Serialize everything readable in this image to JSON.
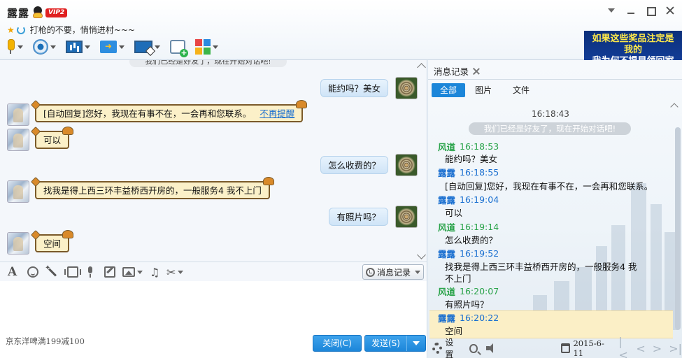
{
  "header": {
    "contact_name": "露露",
    "vip_badge": "VIP2",
    "signature": "打枪的不要，悄悄进村~~~"
  },
  "ad_banner": {
    "line1": "如果这些奖品注定是我的",
    "line2": "我为何不提早领回家"
  },
  "chat": {
    "system_top": "我们已经是好友了，现在开始对话吧!",
    "messages": [
      {
        "from": "me",
        "text": "能约吗？美女"
      },
      {
        "from": "peer",
        "text": "[自动回复]您好，我现在有事不在，一会再和您联系。",
        "link": "不再提醒"
      },
      {
        "from": "peer",
        "text": "可以"
      },
      {
        "from": "me",
        "text": "怎么收费的？"
      },
      {
        "from": "peer",
        "text": "找我是得上西三环丰益桥西开房的，一般服务4   我不上门"
      },
      {
        "from": "me",
        "text": "有照片吗？"
      },
      {
        "from": "peer",
        "text": "空间"
      }
    ]
  },
  "input_toolbar": {
    "history_label": "消息记录"
  },
  "footer": {
    "ad_text": "京东洋啤满199减100",
    "close_label": "关闭(C)",
    "send_label": "发送(S)"
  },
  "history": {
    "tab_label": "消息记录",
    "filters": [
      "全部",
      "图片",
      "文件"
    ],
    "first_time": "16:18:43",
    "system_msg": "我们已经是好友了，现在开始对话吧!",
    "entries": [
      {
        "sender": "风道",
        "time": "16:18:53",
        "type": "peer",
        "text": "能约吗？美女"
      },
      {
        "sender": "露露",
        "time": "16:18:55",
        "type": "me",
        "text": "[自动回复]您好，我现在有事不在，一会再和您联系。"
      },
      {
        "sender": "露露",
        "time": "16:19:04",
        "type": "me",
        "text": "可以"
      },
      {
        "sender": "风道",
        "time": "16:19:14",
        "type": "peer",
        "text": "怎么收费的？"
      },
      {
        "sender": "露露",
        "time": "16:19:52",
        "type": "me",
        "text": "找我是得上西三环丰益桥西开房的，一般服务4   我不上门"
      },
      {
        "sender": "风道",
        "time": "16:20:07",
        "type": "peer",
        "text": "有照片吗？"
      },
      {
        "sender": "露露",
        "time": "16:20:22",
        "type": "me",
        "text": "空间"
      }
    ],
    "settings_label": "设置",
    "date": "2015-6-11"
  }
}
